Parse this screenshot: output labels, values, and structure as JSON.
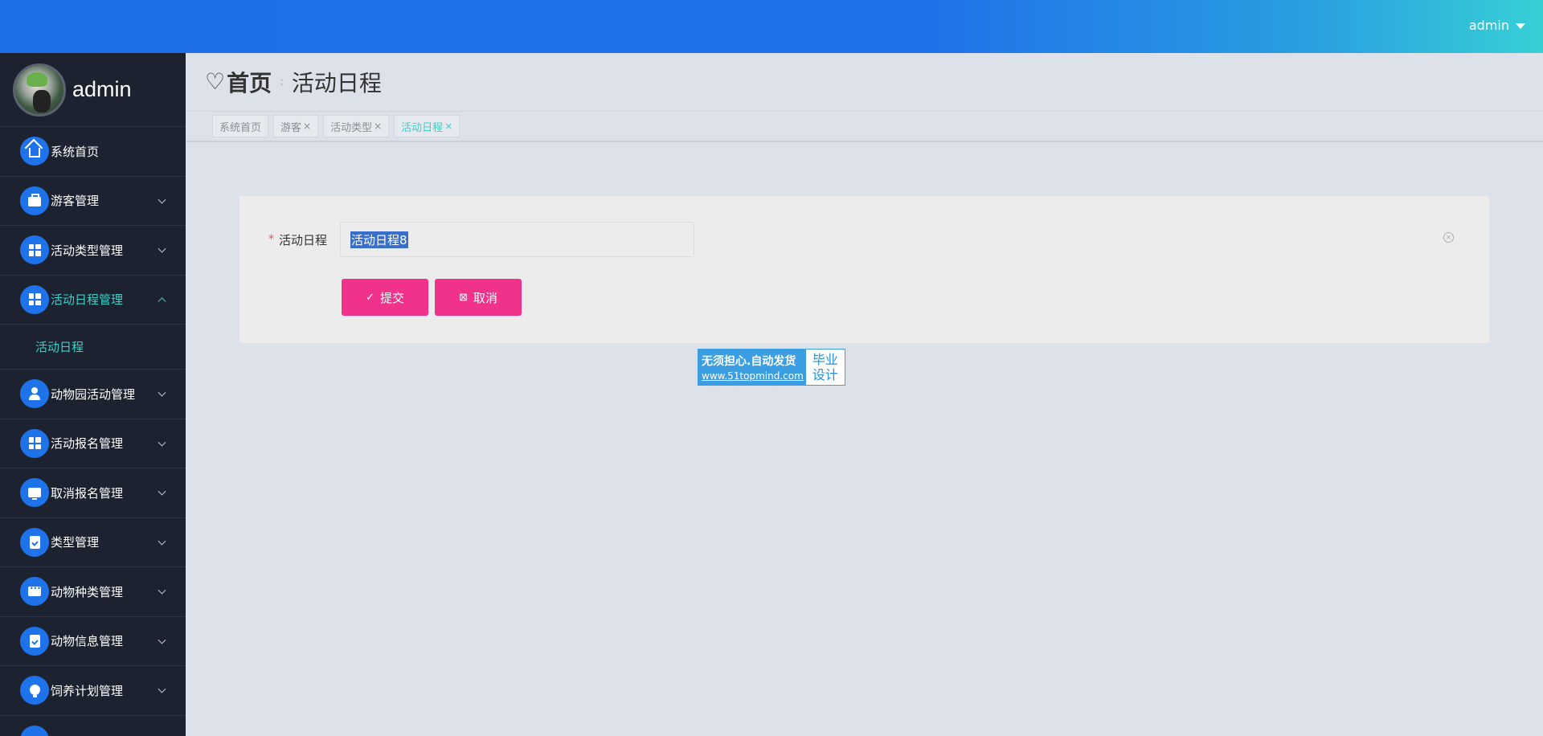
{
  "topbar": {
    "user": "admin"
  },
  "sidebar": {
    "profile_name": "admin",
    "items": [
      {
        "label": "系统首页",
        "icon": "home-icon",
        "expandable": false
      },
      {
        "label": "游客管理",
        "icon": "briefcase-icon",
        "expandable": true
      },
      {
        "label": "活动类型管理",
        "icon": "grid-icon",
        "expandable": true
      },
      {
        "label": "活动日程管理",
        "icon": "grid-icon",
        "expandable": true,
        "expanded": true
      },
      {
        "label": "动物园活动管理",
        "icon": "user-icon",
        "expandable": true
      },
      {
        "label": "活动报名管理",
        "icon": "grid-icon",
        "expandable": true
      },
      {
        "label": "取消报名管理",
        "icon": "monitor-icon",
        "expandable": true
      },
      {
        "label": "类型管理",
        "icon": "clipboard-check-icon",
        "expandable": true
      },
      {
        "label": "动物种类管理",
        "icon": "chat-icon",
        "expandable": true
      },
      {
        "label": "动物信息管理",
        "icon": "clipboard-icon",
        "expandable": true
      },
      {
        "label": "饲养计划管理",
        "icon": "bulb-icon",
        "expandable": true
      }
    ],
    "submenu": {
      "label": "活动日程"
    }
  },
  "breadcrumb": {
    "home": "首页",
    "separator": ":",
    "current": "活动日程"
  },
  "tags": [
    {
      "label": "系统首页",
      "closable": false
    },
    {
      "label": "游客",
      "closable": true
    },
    {
      "label": "活动类型",
      "closable": true
    },
    {
      "label": "活动日程",
      "closable": true,
      "active": true
    }
  ],
  "form": {
    "required_mark": "*",
    "label": "活动日程",
    "value": "活动日程8",
    "submit": "提交",
    "cancel": "取消"
  },
  "watermark": {
    "line1": "无须担心.自动发货",
    "line2": "www.51topmind.com",
    "right1": "毕业",
    "right2": "设计"
  },
  "colors": {
    "accent": "#1f6fe8",
    "active_text": "#3ad1c8",
    "button": "#f0328a",
    "sidebar_bg": "#1c2230"
  }
}
